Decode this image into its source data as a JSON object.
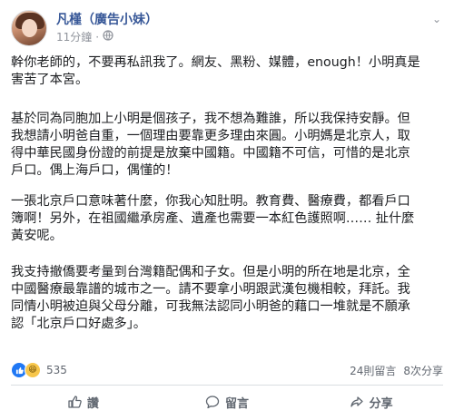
{
  "post": {
    "author": "凡槿（廣告小妹）",
    "time": "11分鐘",
    "privacy_icon": "globe-icon",
    "paragraphs": [
      "幹你老師的，不要再私訊我了。網友、黑粉、媒體，enough！小明真是\n害苦了本宮。",
      "基於同為同胞加上小明是個孩子，我不想為難誰，所以我保持安靜。但\n我想請小明爸自重，一個理由要靠更多理由來圓。小明媽是北京人，取\n得中華民國身份證的前提是放棄中國籍。中國籍不可信，可惜的是北京\n戶口。偶上海戶口，偶懂的！",
      "一張北京戶口意味著什麼，你我心知肚明。教育費、醫療費，都看戶口\n簿啊！另外，在祖國繼承房產、遺產也需要一本紅色護照啊…… 扯什麼\n黃安呢。",
      "我支持撤僑要考量到台灣籍配偶和子女。但是小明的所在地是北京，全\n中國醫療最靠譜的城市之一。請不要拿小明跟武漢包機相較，拜託。我\n同情小明被迫與父母分離，可我無法認同小明爸的藉口一堆就是不願承\n認「北京戶口好處多」。"
    ]
  },
  "stats": {
    "reactions": "535",
    "comments": "24則留言",
    "shares": "8次分享"
  },
  "actions": {
    "like": "讚",
    "comment": "留言",
    "share": "分享"
  },
  "colors": {
    "name": "#385898",
    "like_blue": "#2078f4",
    "haha_yellow": "#f7c64b"
  }
}
